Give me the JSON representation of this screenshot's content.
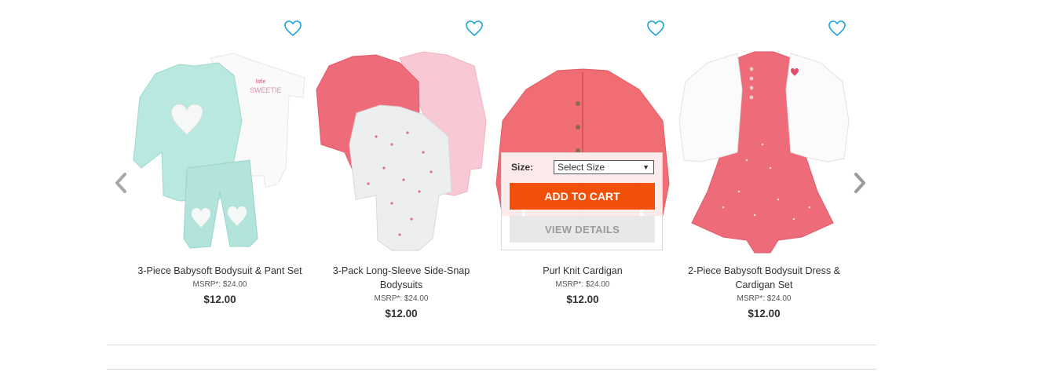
{
  "carousel": {
    "prev_icon": "chevron-left-icon",
    "next_icon": "chevron-right-icon",
    "products": [
      {
        "name": "3-Piece Babysoft Bodysuit & Pant Set",
        "msrp": "MSRP*: $24.00",
        "price": "$12.00",
        "image": "mint-heart-set-image"
      },
      {
        "name": "3-Pack Long-Sleeve Side-Snap Bodysuits",
        "msrp": "MSRP*: $24.00",
        "price": "$12.00",
        "image": "pink-bodysuits-image"
      },
      {
        "name": "Purl Knit Cardigan",
        "msrp": "MSRP*: $24.00",
        "price": "$12.00",
        "image": "coral-cardigan-image"
      },
      {
        "name": "2-Piece Babysoft Bodysuit Dress & Cardigan Set",
        "msrp": "MSRP*: $24.00",
        "price": "$12.00",
        "image": "dress-cardigan-set-image"
      }
    ],
    "quick_add": {
      "size_label": "Size:",
      "size_value": "Select Size",
      "add_to_cart": "ADD TO CART",
      "view_details": "VIEW DETAILS"
    }
  },
  "colors": {
    "accent_orange": "#f24f0a",
    "heart_blue": "#1aa3d6",
    "arrow_gray": "#9a9a9a"
  }
}
